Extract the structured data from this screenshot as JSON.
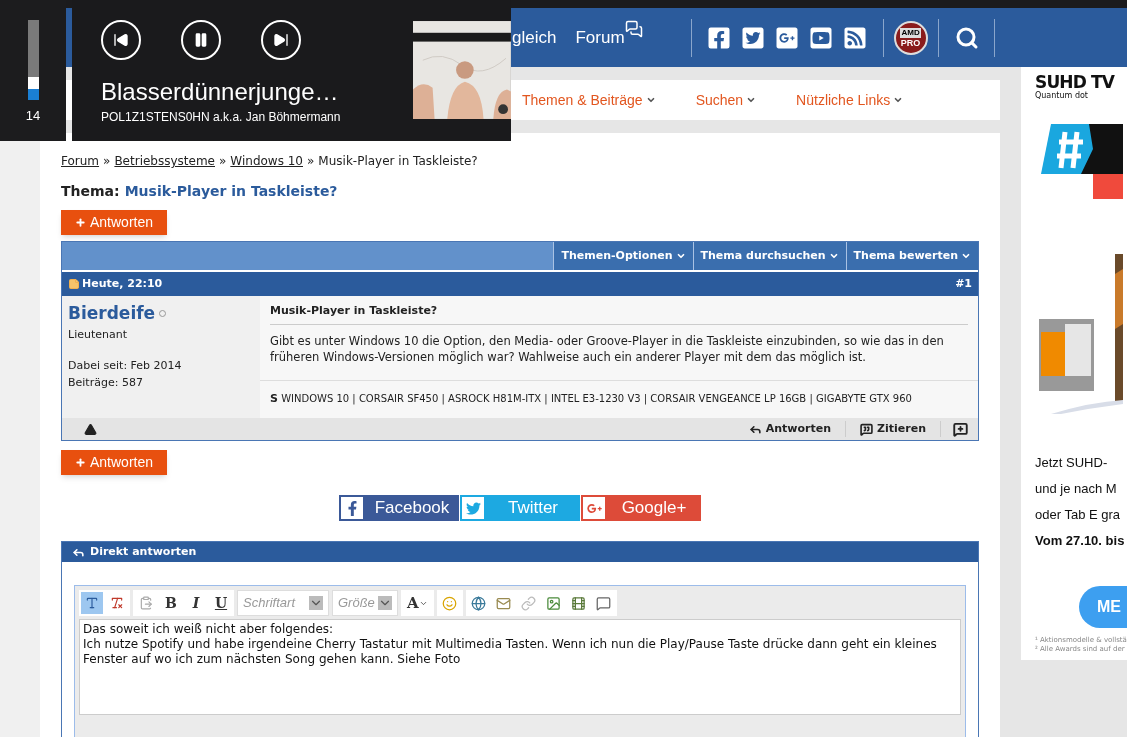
{
  "media_popup": {
    "volume": {
      "level": 0.14,
      "reading": "14"
    },
    "title": "Blasserdünnerjunge…",
    "artist": "POL1Z1STENS0HN a.k.a. Jan Böhmermann",
    "playing": true
  },
  "header": {
    "nav": [
      {
        "label": "gleich",
        "kind": "plain"
      },
      {
        "label": "Forum",
        "kind": "chat"
      }
    ],
    "socials": [
      {
        "kind": "facebook"
      },
      {
        "kind": "twitter"
      },
      {
        "kind": "googleplus"
      },
      {
        "kind": "youtube"
      },
      {
        "kind": "rss"
      }
    ],
    "badge": {
      "line1": "AMD",
      "line2": "PRO"
    }
  },
  "subnav": [
    {
      "label": "Themen & Beiträge"
    },
    {
      "label": "Suchen"
    },
    {
      "label": "Nützliche Links"
    }
  ],
  "breadcrumb": {
    "links": [
      "Forum",
      "Betriebssysteme",
      "Windows 10"
    ],
    "separator": "»",
    "current": "Musik-Player in Taskleiste?"
  },
  "thread": {
    "label": "Thema:",
    "title": "Musik-Player in Taskleiste?"
  },
  "reply_button": "Antworten",
  "thread_tools": [
    "Themen-Optionen",
    "Thema durchsuchen",
    "Thema bewerten"
  ],
  "post": {
    "date": "Heute, 22:10",
    "number": "#1",
    "author": "Bierdeife",
    "online": false,
    "rank": "Lieutenant",
    "joined": "Dabei seit: Feb 2014",
    "posts": "Beiträge: 587",
    "title": "Musik-Player in Taskleiste?",
    "body": "Gibt es unter Windows 10 die Option, den Media- oder Groove-Player in die Taskleiste einzubinden, so wie das in den früheren Windows-Versionen möglich war? Wahlweise auch ein anderer Player mit dem das möglich ist.",
    "signature_label": "S",
    "signature": "WINDOWS 10 | CORSAIR SF450 | ASROCK H81M-ITX | INTEL E3-1230 V3 | CORSAIR VENGEANCE LP 16GB | GIGABYTE GTX 960",
    "actions": [
      "Antworten",
      "Zitieren"
    ]
  },
  "reply_button_bottom": "Antworten",
  "share": [
    {
      "kind": "facebook",
      "label": "Facebook"
    },
    {
      "kind": "twitter",
      "label": "Twitter"
    },
    {
      "kind": "googleplus",
      "label": "Google+"
    }
  ],
  "quick_reply": {
    "title": "Direkt antworten",
    "wysiwyg_on": true,
    "bold": "B",
    "italic": "I",
    "underline": "U",
    "font_placeholder": "Schriftart",
    "size_placeholder": "Größe",
    "font_color": "A",
    "lines": [
      "Das soweit ich weiß nicht aber folgendes:",
      "Ich nutze Spotify und habe irgendeine Cherry Tastatur mit Multimedia Tasten. Wenn ich nun die Play/Pause Taste drücke dann geht ein kleines Fenster auf wo ich zum nächsten Song gehen kann. Siehe Foto"
    ]
  },
  "ad": {
    "brand": "SUHD TV",
    "tagline": "Quantum dot",
    "lines": [
      "Jetzt SUHD-",
      "und je nach M",
      "oder Tab E gra"
    ],
    "bold_line": "Vom 27.10. bis",
    "cta": "ME",
    "footnotes": [
      "¹ Aktionsmodelle & vollstä",
      "² Alle Awards sind auf der"
    ]
  }
}
